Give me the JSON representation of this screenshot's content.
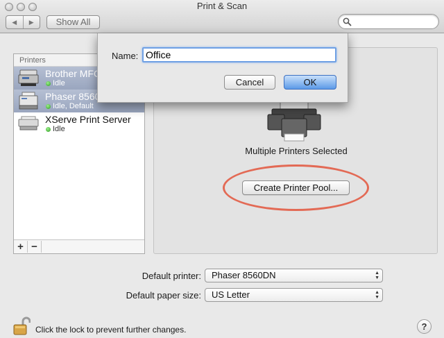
{
  "window": {
    "title": "Print & Scan"
  },
  "toolbar": {
    "back_glyph": "◀",
    "forward_glyph": "▶",
    "show_all_label": "Show All",
    "search_placeholder": ""
  },
  "printers": {
    "header": "Printers",
    "items": [
      {
        "name": "Brother MFC",
        "status": "Idle",
        "selected": true,
        "icon": "mfc-printer-icon"
      },
      {
        "name": "Phaser 8560",
        "status": "Idle, Default",
        "selected": true,
        "icon": "laser-printer-icon"
      },
      {
        "name": "XServe Print Server",
        "status": "Idle",
        "selected": false,
        "icon": "print-server-icon"
      }
    ],
    "add_label": "+",
    "remove_label": "−"
  },
  "details": {
    "multi_label": "Multiple Printers Selected",
    "pool_button_label": "Create Printer Pool...",
    "highlight_color": "#e36a55"
  },
  "settings": {
    "default_printer_label": "Default printer:",
    "default_printer_value": "Phaser 8560DN",
    "paper_size_label": "Default paper size:",
    "paper_size_value": "US Letter"
  },
  "footer": {
    "lock_text": "Click the lock to prevent further changes.",
    "help_label": "?"
  },
  "sheet": {
    "name_label": "Name:",
    "name_value": "Office",
    "cancel_label": "Cancel",
    "ok_label": "OK"
  }
}
